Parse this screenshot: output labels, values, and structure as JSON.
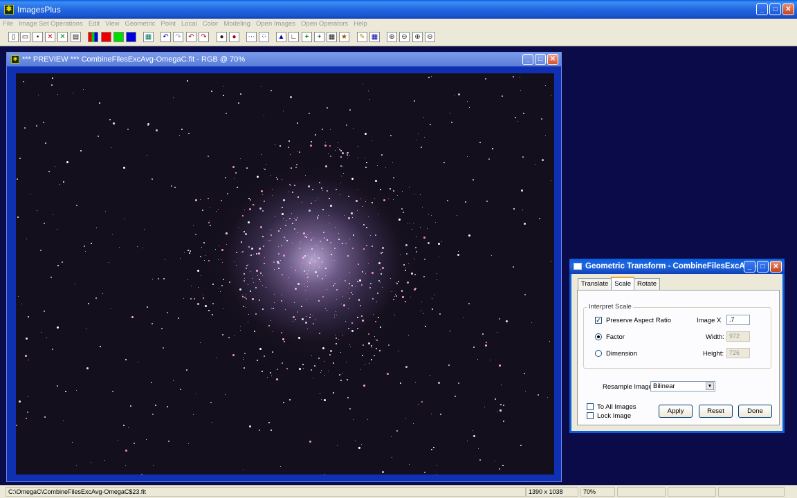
{
  "app": {
    "title": "ImagesPlus"
  },
  "menu": [
    "File",
    "Image Set Operations",
    "Edit",
    "View",
    "Geometric",
    "Point",
    "Local",
    "Color",
    "Modeling",
    "Open Images",
    "Open Operators",
    "Help"
  ],
  "image_window": {
    "title": "*** PREVIEW *** CombineFilesExcAvg-OmegaC.fit - RGB @ 70%"
  },
  "dialog": {
    "title": "Geometric Transform - CombineFilesExcAvg-...",
    "tabs": [
      "Translate",
      "Scale",
      "Rotate"
    ],
    "active_tab": "Scale",
    "group_label": "Interpret Scale",
    "preserve_aspect_label": "Preserve Aspect Ratio",
    "preserve_aspect_checked": true,
    "factor_label": "Factor",
    "dimension_label": "Dimension",
    "image_x_label": "Image  X",
    "image_x_value": ".7",
    "width_label": "Width:",
    "width_value": "972",
    "height_label": "Height:",
    "height_value": "726",
    "resample_label": "Resample Image:",
    "resample_value": "Bilinear",
    "to_all_label": "To All Images",
    "lock_label": "Lock Image",
    "apply": "Apply",
    "reset": "Reset",
    "done": "Done"
  },
  "status": {
    "path": "C:\\OmegaC\\CombineFilesExcAvg-OmegaC$23.fit",
    "dims": "1390 x 1038",
    "zoom": "70%"
  }
}
